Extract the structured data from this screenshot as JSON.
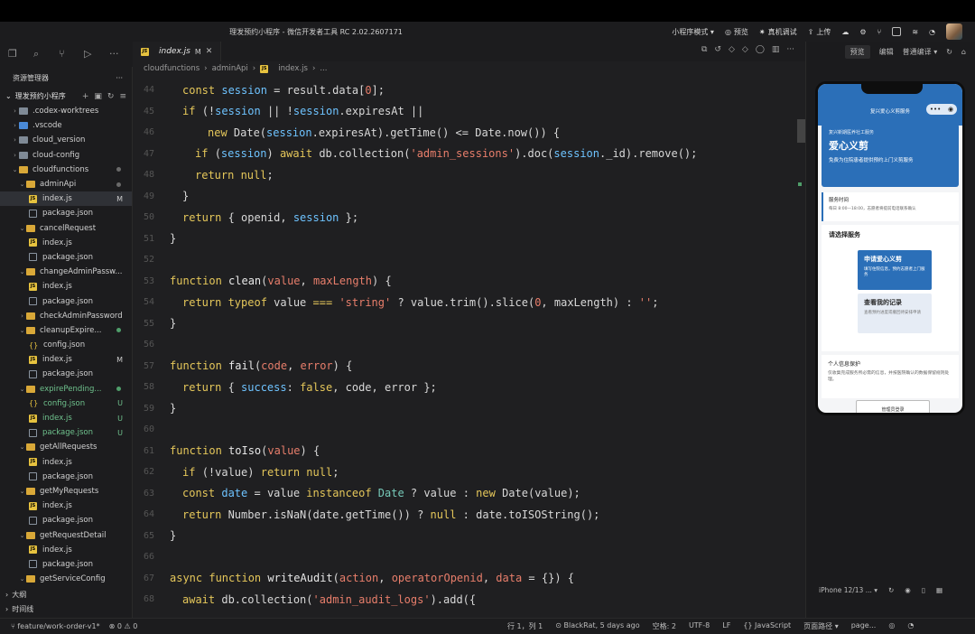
{
  "window": {
    "title": "理发预约小程序 - 微信开发者工具 RC 2.02.2607171"
  },
  "toolbar": {
    "mode": "小程序模式 ▾",
    "preview": "预览",
    "real_debug": "真机调试",
    "upload": "上传"
  },
  "sidebar": {
    "title": "资源管理器",
    "more": "···",
    "project": "理发预约小程序",
    "tree": [
      {
        "label": ".codex-worktrees",
        "type": "folder-grey",
        "indent": 1,
        "chev": "›"
      },
      {
        "label": ".vscode",
        "type": "folder-blue",
        "indent": 1,
        "chev": "›"
      },
      {
        "label": "cloud_version",
        "type": "folder-grey",
        "indent": 1,
        "chev": "›"
      },
      {
        "label": "cloud-config",
        "type": "folder-grey",
        "indent": 1,
        "chev": "›"
      },
      {
        "label": "cloudfunctions",
        "type": "folder",
        "indent": 1,
        "chev": "⌄",
        "dot": "grey"
      },
      {
        "label": "adminApi",
        "type": "folder",
        "indent": 2,
        "chev": "⌄",
        "dot": "grey"
      },
      {
        "label": "index.js",
        "type": "js",
        "indent": 3,
        "badge": "M",
        "sel": true
      },
      {
        "label": "package.json",
        "type": "json",
        "indent": 3
      },
      {
        "label": "cancelRequest",
        "type": "folder",
        "indent": 2,
        "chev": "⌄"
      },
      {
        "label": "index.js",
        "type": "js",
        "indent": 3
      },
      {
        "label": "package.json",
        "type": "json",
        "indent": 3
      },
      {
        "label": "changeAdminPassw...",
        "type": "folder",
        "indent": 2,
        "chev": "⌄"
      },
      {
        "label": "index.js",
        "type": "js",
        "indent": 3
      },
      {
        "label": "package.json",
        "type": "json",
        "indent": 3
      },
      {
        "label": "checkAdminPassword",
        "type": "folder",
        "indent": 2,
        "chev": "›"
      },
      {
        "label": "cleanupExpire...",
        "type": "folder",
        "indent": 2,
        "chev": "⌄",
        "dot": "green"
      },
      {
        "label": "config.json",
        "type": "cfg",
        "indent": 3
      },
      {
        "label": "index.js",
        "type": "js",
        "indent": 3,
        "badge": "M"
      },
      {
        "label": "package.json",
        "type": "json",
        "indent": 3
      },
      {
        "label": "expirePending...",
        "type": "folder",
        "indent": 2,
        "chev": "⌄",
        "dot": "green",
        "green": true
      },
      {
        "label": "config.json",
        "type": "cfg",
        "indent": 3,
        "badge": "U",
        "green": true
      },
      {
        "label": "index.js",
        "type": "js",
        "indent": 3,
        "badge": "U",
        "green": true
      },
      {
        "label": "package.json",
        "type": "json",
        "indent": 3,
        "badge": "U",
        "green": true
      },
      {
        "label": "getAllRequests",
        "type": "folder",
        "indent": 2,
        "chev": "⌄"
      },
      {
        "label": "index.js",
        "type": "js",
        "indent": 3
      },
      {
        "label": "package.json",
        "type": "json",
        "indent": 3
      },
      {
        "label": "getMyRequests",
        "type": "folder",
        "indent": 2,
        "chev": "⌄"
      },
      {
        "label": "index.js",
        "type": "js",
        "indent": 3
      },
      {
        "label": "package.json",
        "type": "json",
        "indent": 3
      },
      {
        "label": "getRequestDetail",
        "type": "folder",
        "indent": 2,
        "chev": "⌄"
      },
      {
        "label": "index.js",
        "type": "js",
        "indent": 3
      },
      {
        "label": "package.json",
        "type": "json",
        "indent": 3
      },
      {
        "label": "getServiceConfig",
        "type": "folder",
        "indent": 2,
        "chev": "⌄"
      }
    ],
    "outline": "大纲",
    "timeline": "时间线"
  },
  "editor": {
    "tab_label": "index.js",
    "tab_badge": "M",
    "breadcrumb": [
      "cloudfunctions",
      "adminApi",
      "index.js",
      "..."
    ],
    "lines": [
      {
        "n": "44",
        "indent": 1,
        "code": [
          [
            "kw",
            "const "
          ],
          [
            "var",
            "session"
          ],
          [
            "pl",
            " = result.data["
          ],
          [
            "str",
            "0"
          ],
          [
            "pl",
            "];"
          ]
        ]
      },
      {
        "n": "45",
        "indent": 1,
        "code": [
          [
            "kw",
            "if "
          ],
          [
            "pl",
            "(!"
          ],
          [
            "var",
            "session"
          ],
          [
            "pl",
            " || !"
          ],
          [
            "var",
            "session"
          ],
          [
            "pl",
            ".expiresAt ||"
          ]
        ]
      },
      {
        "n": "46",
        "indent": 3,
        "code": [
          [
            "kw",
            "new "
          ],
          [
            "pl",
            "Date("
          ],
          [
            "var",
            "session"
          ],
          [
            "pl",
            ".expiresAt).getTime() <= Date.now()) {"
          ]
        ]
      },
      {
        "n": "47",
        "indent": 2,
        "code": [
          [
            "kw",
            "if "
          ],
          [
            "pl",
            "("
          ],
          [
            "var",
            "session"
          ],
          [
            "pl",
            ") "
          ],
          [
            "kw",
            "await "
          ],
          [
            "pl",
            "db.collection("
          ],
          [
            "str",
            "'admin_sessions'"
          ],
          [
            "pl",
            ").doc("
          ],
          [
            "var",
            "session"
          ],
          [
            "pl",
            "._id).remove();"
          ]
        ]
      },
      {
        "n": "48",
        "indent": 2,
        "code": [
          [
            "kw",
            "return "
          ],
          [
            "kw",
            "null"
          ],
          [
            "pl",
            ";"
          ]
        ]
      },
      {
        "n": "49",
        "indent": 1,
        "code": [
          [
            "pl",
            "}"
          ]
        ]
      },
      {
        "n": "50",
        "indent": 1,
        "code": [
          [
            "kw",
            "return "
          ],
          [
            "pl",
            "{ openid, "
          ],
          [
            "var",
            "session"
          ],
          [
            "pl",
            " };"
          ]
        ]
      },
      {
        "n": "51",
        "indent": 0,
        "code": [
          [
            "pl",
            "}"
          ]
        ]
      },
      {
        "n": "52",
        "indent": 0,
        "code": []
      },
      {
        "n": "53",
        "indent": 0,
        "code": [
          [
            "kw",
            "function "
          ],
          [
            "fn",
            "clean"
          ],
          [
            "pl",
            "("
          ],
          [
            "param",
            "value"
          ],
          [
            "pl",
            ", "
          ],
          [
            "param",
            "maxLength"
          ],
          [
            "pl",
            ") {"
          ]
        ]
      },
      {
        "n": "54",
        "indent": 1,
        "code": [
          [
            "kw",
            "return "
          ],
          [
            "kw",
            "typeof "
          ],
          [
            "pl",
            "value "
          ],
          [
            "op",
            "==="
          ],
          [
            "pl",
            " "
          ],
          [
            "str",
            "'string'"
          ],
          [
            "pl",
            " ? value.trim().slice("
          ],
          [
            "str",
            "0"
          ],
          [
            "pl",
            ", maxLength) : "
          ],
          [
            "str",
            "''"
          ],
          [
            "pl",
            ";"
          ]
        ]
      },
      {
        "n": "55",
        "indent": 0,
        "code": [
          [
            "pl",
            "}"
          ]
        ]
      },
      {
        "n": "56",
        "indent": 0,
        "code": []
      },
      {
        "n": "57",
        "indent": 0,
        "code": [
          [
            "kw",
            "function "
          ],
          [
            "fn",
            "fail"
          ],
          [
            "pl",
            "("
          ],
          [
            "param",
            "code"
          ],
          [
            "pl",
            ", "
          ],
          [
            "param",
            "error"
          ],
          [
            "pl",
            ") {"
          ]
        ]
      },
      {
        "n": "58",
        "indent": 1,
        "code": [
          [
            "kw",
            "return "
          ],
          [
            "pl",
            "{ "
          ],
          [
            "var",
            "success"
          ],
          [
            "pl",
            ": "
          ],
          [
            "kw",
            "false"
          ],
          [
            "pl",
            ", code, error };"
          ]
        ]
      },
      {
        "n": "59",
        "indent": 0,
        "code": [
          [
            "pl",
            "}"
          ]
        ]
      },
      {
        "n": "60",
        "indent": 0,
        "code": []
      },
      {
        "n": "61",
        "indent": 0,
        "code": [
          [
            "kw",
            "function "
          ],
          [
            "fn",
            "toIso"
          ],
          [
            "pl",
            "("
          ],
          [
            "param",
            "value"
          ],
          [
            "pl",
            ") {"
          ]
        ]
      },
      {
        "n": "62",
        "indent": 1,
        "code": [
          [
            "kw",
            "if "
          ],
          [
            "pl",
            "(!value) "
          ],
          [
            "kw",
            "return "
          ],
          [
            "kw",
            "null"
          ],
          [
            "pl",
            ";"
          ]
        ]
      },
      {
        "n": "63",
        "indent": 1,
        "code": [
          [
            "kw",
            "const "
          ],
          [
            "var",
            "date"
          ],
          [
            "pl",
            " = value "
          ],
          [
            "kw",
            "instanceof "
          ],
          [
            "cls",
            "Date"
          ],
          [
            "pl",
            " ? value : "
          ],
          [
            "kw",
            "new "
          ],
          [
            "pl",
            "Date(value);"
          ]
        ]
      },
      {
        "n": "64",
        "indent": 1,
        "code": [
          [
            "kw",
            "return "
          ],
          [
            "pl",
            "Number.isNaN(date.getTime()) ? "
          ],
          [
            "kw",
            "null"
          ],
          [
            "pl",
            " : date.toISOString();"
          ]
        ]
      },
      {
        "n": "65",
        "indent": 0,
        "code": [
          [
            "pl",
            "}"
          ]
        ]
      },
      {
        "n": "66",
        "indent": 0,
        "code": []
      },
      {
        "n": "67",
        "indent": 0,
        "code": [
          [
            "kw",
            "async "
          ],
          [
            "kw",
            "function "
          ],
          [
            "fn",
            "writeAudit"
          ],
          [
            "pl",
            "("
          ],
          [
            "param",
            "action"
          ],
          [
            "pl",
            ", "
          ],
          [
            "param",
            "operatorOpenid"
          ],
          [
            "pl",
            ", "
          ],
          [
            "param",
            "data"
          ],
          [
            "pl",
            " = {}) {"
          ]
        ]
      },
      {
        "n": "68",
        "indent": 1,
        "code": [
          [
            "kw",
            "await "
          ],
          [
            "pl",
            "db.collection("
          ],
          [
            "str",
            "'admin_audit_logs'"
          ],
          [
            "pl",
            ").add({"
          ]
        ]
      }
    ]
  },
  "simulator": {
    "preview_btn": "预览",
    "edit_btn": "编辑",
    "compile": "普通编译 ▾",
    "page_title": "复兴爱心义剪服务",
    "hero_small": "复兴新期医养社工服务",
    "hero_big": "爱心义剪",
    "hero_sub": "免费为住院患者提供预约上门义剪服务",
    "info_title": "服务时间",
    "info_desc": "每日 8:00—18:00，志愿者将提前电话联系确认",
    "choose_title": "请选择服务",
    "card1_title": "申请爱心义剪",
    "card1_desc": "填写住院信息，预约志愿者上门服务",
    "card2_title": "查看我的记录",
    "card2_desc": "查看预约进度或撤回待安排申请",
    "priv_title": "个人信息保护",
    "priv_desc": "仅收集完成服务所必需的信息，并按医院确认的数据保留规则处理。",
    "bottom_btn": "管理员登录",
    "device": "iPhone 12/13 ... ▾"
  },
  "status": {
    "branch": "feature/work-order-v1*",
    "problems": "⊗ 0 ⚠ 0",
    "position": "行 1，列 1",
    "blame": "BlackRat, 5 days ago",
    "spaces": "空格: 2",
    "encoding": "UTF-8",
    "eol": "LF",
    "language": "{} JavaScript",
    "page_path": "页面路径 ▾",
    "page": "page..."
  }
}
